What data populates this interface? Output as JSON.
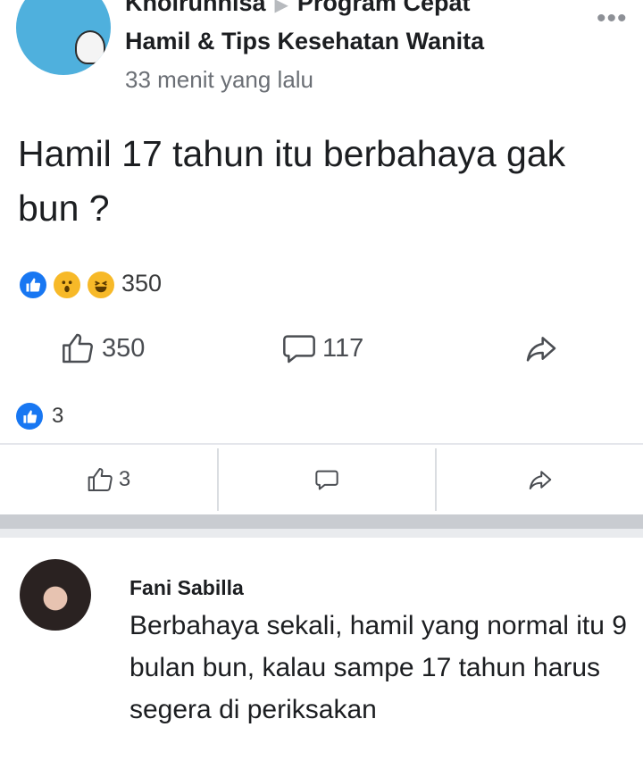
{
  "post": {
    "author": "Kholrunnisa",
    "group": "Program Cepat",
    "group_line2": "Hamil & Tips Kesehatan Wanita",
    "timestamp": "33 menit yang lalu",
    "text": "Hamil 17 tahun itu berbahaya gak bun ?",
    "reactions_count": "350",
    "likes": "350",
    "comments": "117",
    "more_icon": "more-dots-icon"
  },
  "comment_preview": {
    "like_count": "3",
    "bar_like_count": "3"
  },
  "comment": {
    "name": "Fani Sabilla",
    "text": "Berbahaya sekali, hamil yang normal itu 9 bulan bun, kalau sampe 17 tahun harus segera di periksakan"
  },
  "colors": {
    "accent": "#1877f2",
    "reaction_yellow": "#f7b928",
    "text_secondary": "#6b6f75"
  }
}
